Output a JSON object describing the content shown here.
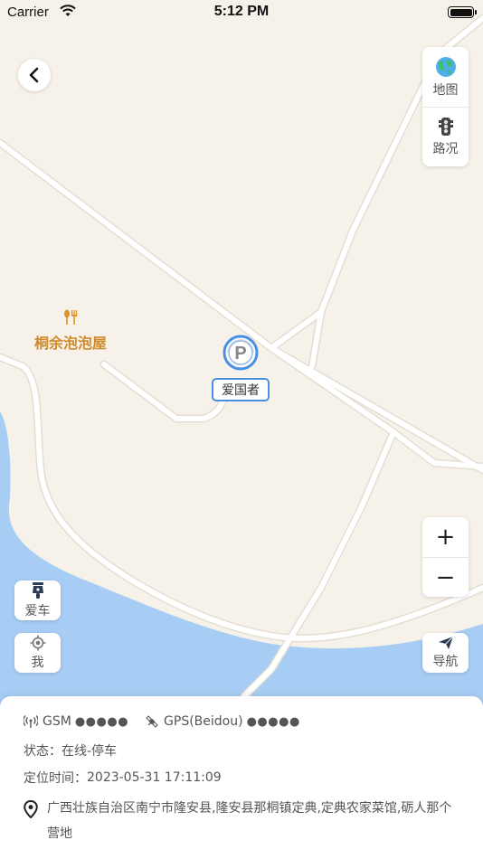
{
  "status_bar": {
    "carrier": "Carrier",
    "time": "5:12 PM"
  },
  "map_controls": {
    "layer_map_label": "地图",
    "traffic_label": "路况",
    "zoom_in": "+",
    "zoom_out": "−",
    "car_label": "爱车",
    "me_label": "我",
    "navigate_label": "导航"
  },
  "map": {
    "poi_restaurant": "桐余泡泡屋",
    "car_marker_label": "爱国者",
    "colors": {
      "land": "#f6f2ea",
      "water": "#a8cdf5",
      "road": "#ffffff",
      "road_edge": "#e4ded2",
      "accent": "#4a90e2"
    }
  },
  "info": {
    "gsm_label": "GSM",
    "gsm_strength": "●●●●●",
    "gps_label": "GPS(Beidou)",
    "gps_strength": "●●●●●",
    "status_label": "状态：",
    "status_value": "在线-停车",
    "time_label": "定位时间：",
    "time_value": "2023-05-31 17:11:09",
    "address": "广西壮族自治区南宁市隆安县,隆安县那桐镇定典,定典农家菜馆,砺人那个营地"
  }
}
